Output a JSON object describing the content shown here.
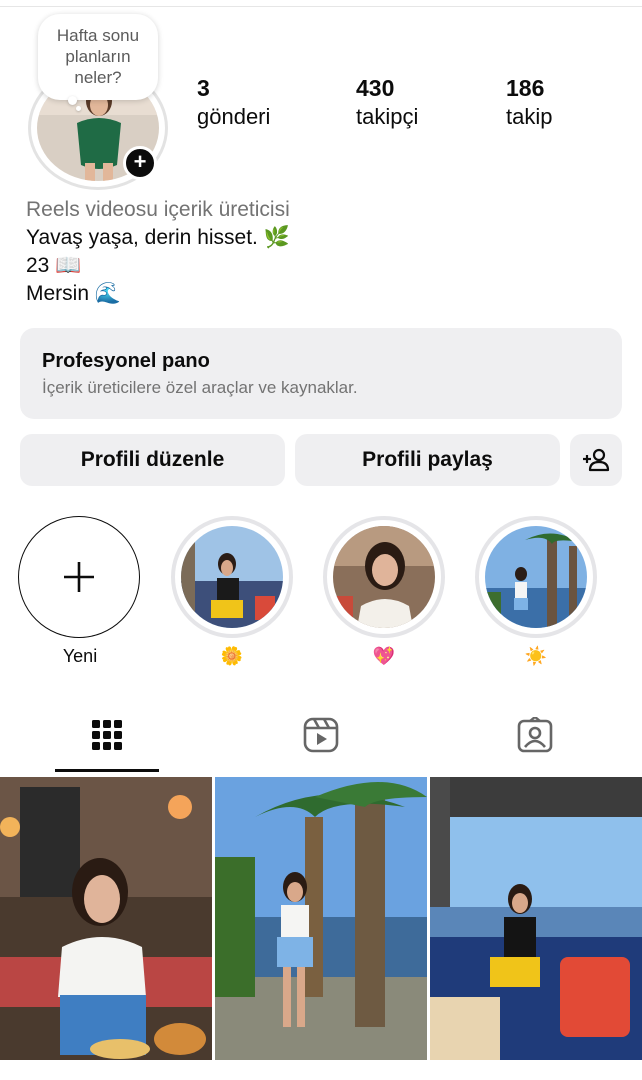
{
  "profile": {
    "note_lines": [
      "Hafta sonu",
      "planların",
      "neler?"
    ]
  },
  "stats": [
    {
      "value": "3",
      "label": "gönderi"
    },
    {
      "value": "430",
      "label": "takipçi"
    },
    {
      "value": "186",
      "label": "takip"
    }
  ],
  "bio": {
    "category": "Reels videosu içerik üreticisi",
    "lines": [
      "Yavaş yaşa, derin hisset. 🌿",
      "23 📖",
      "Mersin 🌊"
    ]
  },
  "professional_dashboard": {
    "title": "Profesyonel pano",
    "subtitle": "İçerik üreticilere özel araçlar ve kaynaklar."
  },
  "buttons": {
    "edit": "Profili düzenle",
    "share": "Profili paylaş"
  },
  "highlights": [
    {
      "label": "Yeni",
      "icon": "plus-icon"
    },
    {
      "label": "🌼"
    },
    {
      "label": "💖"
    },
    {
      "label": "☀️"
    }
  ],
  "tabs": [
    {
      "icon": "grid-icon",
      "active": true
    },
    {
      "icon": "reels-icon",
      "active": false
    },
    {
      "icon": "tagged-icon",
      "active": false
    }
  ],
  "colors": {
    "text": "#0c0c0c",
    "secondary_text": "#737373",
    "button_bg": "#efeff1",
    "ring": "#e3e3e3"
  }
}
